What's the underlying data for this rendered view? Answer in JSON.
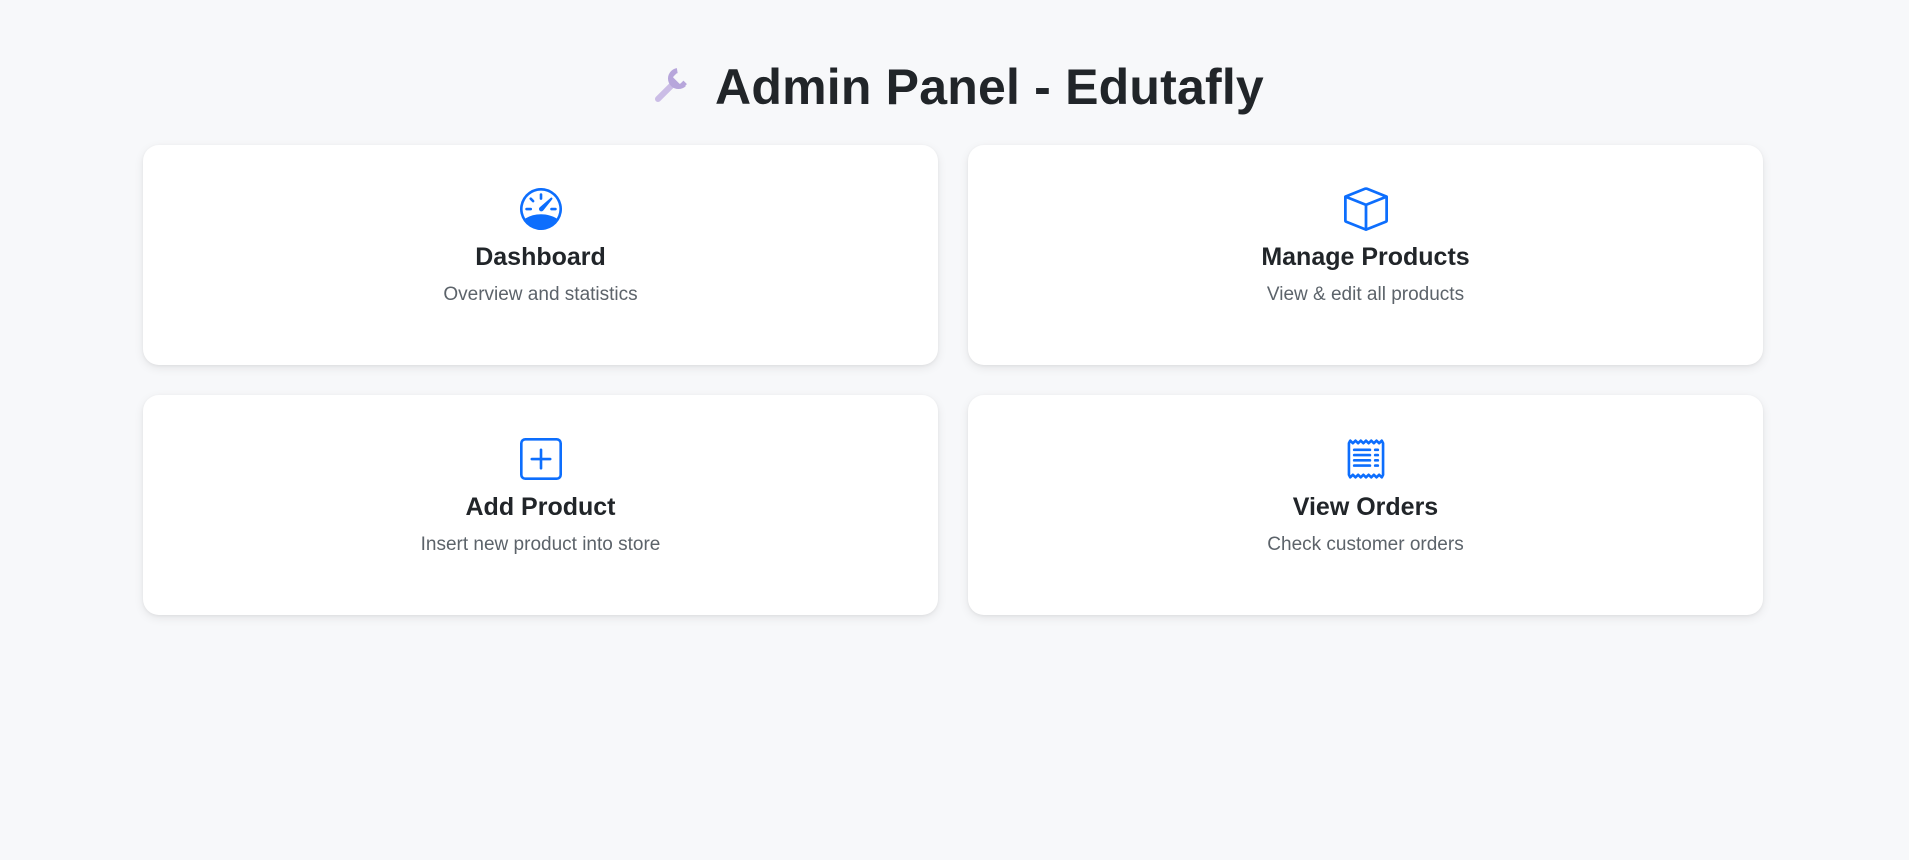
{
  "header": {
    "icon": "wrench-icon",
    "title": "Admin Panel - Edutafly"
  },
  "accent_color": "#0d6efd",
  "cards": [
    {
      "icon": "speedometer-icon",
      "title": "Dashboard",
      "description": "Overview and statistics"
    },
    {
      "icon": "box-icon",
      "title": "Manage Products",
      "description": "View & edit all products"
    },
    {
      "icon": "plus-square-icon",
      "title": "Add Product",
      "description": "Insert new product into store"
    },
    {
      "icon": "receipt-icon",
      "title": "View Orders",
      "description": "Check customer orders"
    }
  ]
}
